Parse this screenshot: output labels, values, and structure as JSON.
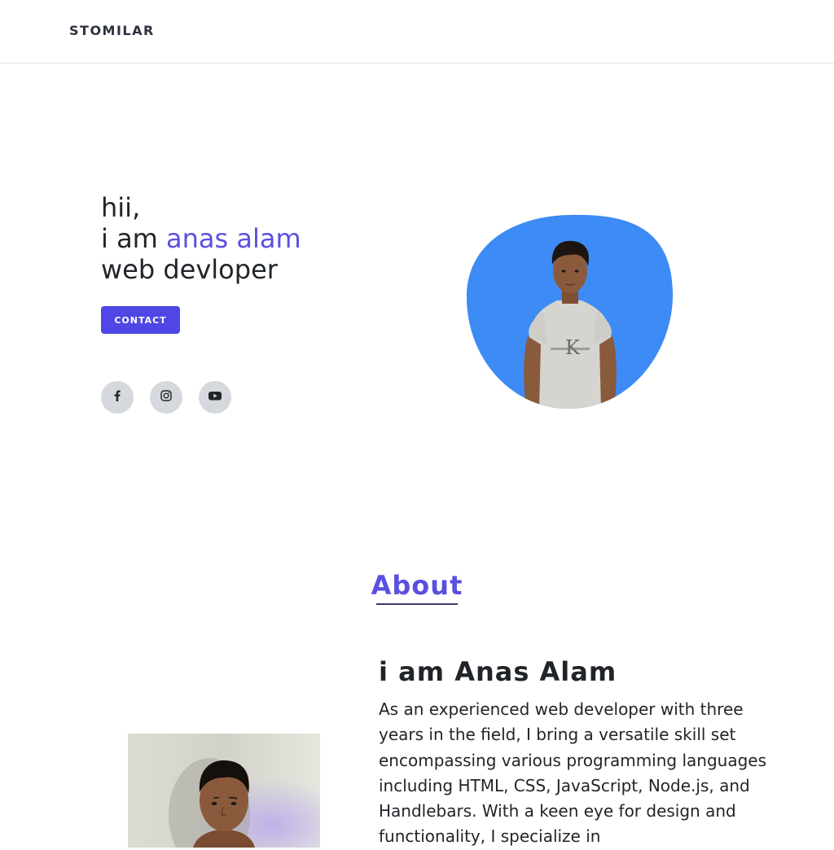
{
  "header": {
    "logo": "STOMILAR"
  },
  "hero": {
    "greeting": "hii,",
    "intro_prefix": "i am ",
    "name": "anas alam",
    "role": "web devloper",
    "contact_label": "CONTACT",
    "social": [
      {
        "name": "facebook",
        "icon": "facebook-icon"
      },
      {
        "name": "instagram",
        "icon": "instagram-icon"
      },
      {
        "name": "youtube",
        "icon": "youtube-icon"
      }
    ]
  },
  "about": {
    "title": "About",
    "heading": "i am Anas Alam",
    "paragraph": "As an experienced web developer with three years in the field, I bring a versatile skill set encompassing various programming languages including HTML, CSS, JavaScript, Node.js, and Handlebars. With a keen eye for design and functionality, I specialize in"
  },
  "colors": {
    "accent": "#5b4fe0",
    "button": "#4f46e5",
    "blob": "#3d8bf5",
    "social_bg": "#d5d9de"
  }
}
